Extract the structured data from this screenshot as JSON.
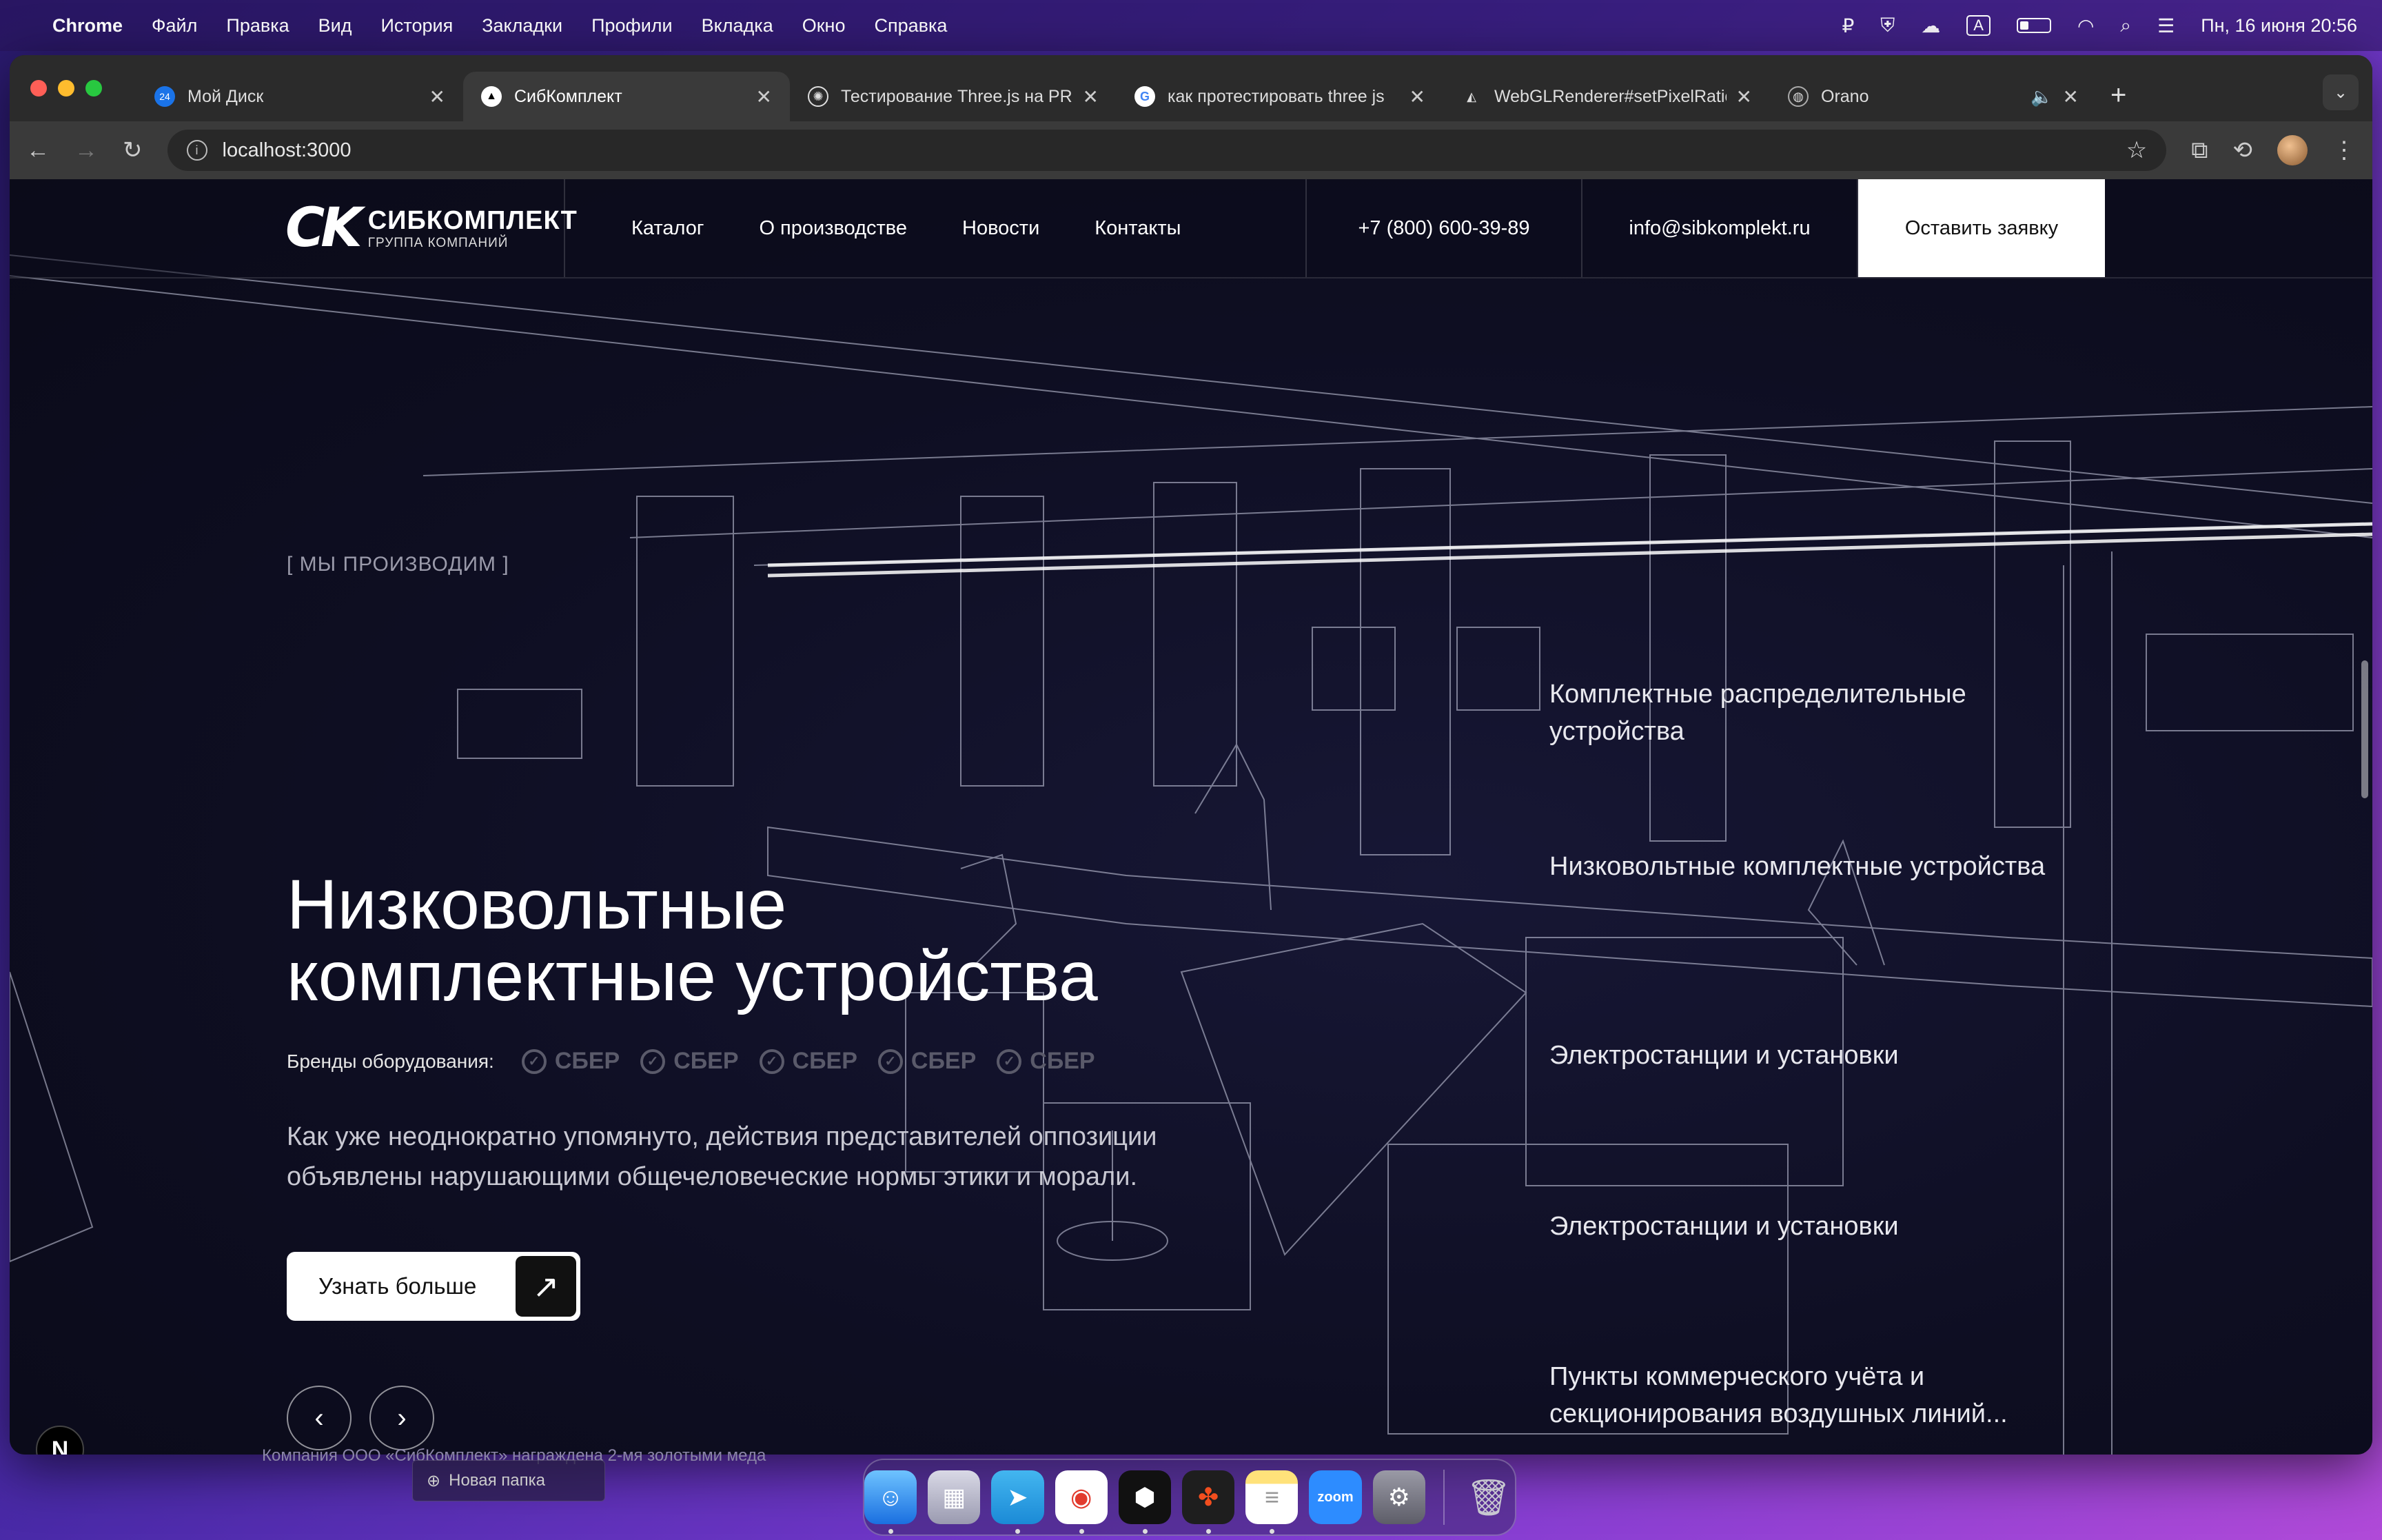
{
  "menubar": {
    "app": "Chrome",
    "items": [
      "Файл",
      "Правка",
      "Вид",
      "История",
      "Закладки",
      "Профили",
      "Вкладка",
      "Окно",
      "Справка"
    ],
    "input_indicator": "A",
    "datetime": "Пн, 16 июня  20:56"
  },
  "browser": {
    "tabs": [
      {
        "title": "Мой Диск",
        "favicon": "drive-icon",
        "favicon_badge": "24"
      },
      {
        "title": "СибКомплект",
        "favicon": "triangle-icon",
        "active": true
      },
      {
        "title": "Тестирование Three.js на PR",
        "favicon": "openai-icon"
      },
      {
        "title": "как протестировать three js",
        "favicon": "google-icon"
      },
      {
        "title": "WebGLRenderer#setPixelRatio",
        "favicon": "threejs-icon"
      },
      {
        "title": "Orano",
        "favicon": "globe-icon"
      }
    ],
    "url": "localhost:3000"
  },
  "site": {
    "logo": {
      "mark": "CK",
      "title": "СИБКОМПЛЕКТ",
      "subtitle": "ГРУППА КОМПАНИЙ"
    },
    "nav": [
      "Каталог",
      "О производстве",
      "Новости",
      "Контакты"
    ],
    "phone": "+7 (800) 600-39-89",
    "email": "info@sibkomplekt.ru",
    "cta": "Оставить заявку",
    "eyebrow": "[ МЫ ПРОИЗВОДИМ ]",
    "hero_title_line1": "Низковольтные",
    "hero_title_line2": "комплектные устройства",
    "brands_label": "Бренды оборудования:",
    "brands": [
      "СБЕР",
      "СБЕР",
      "СБЕР",
      "СБЕР",
      "СБЕР"
    ],
    "description": "Как уже неоднократно упомянуто, действия представителей оппозиции объявлены нарушающими общечеловеческие нормы этики и морали.",
    "more_button": "Узнать больше",
    "categories": [
      "Комплектные распределительные устройства",
      "Низковольтные комплектные устройства",
      "Электростанции и установки",
      "Электростанции и установки",
      "Пункты коммерческого учёта и секционирования воздушных линий..."
    ],
    "next_badge": "N"
  },
  "desktop": {
    "behind_window_text": "Компания ООО «СибКомплект» награждена 2-мя золотыми меда",
    "folder": "Новая папка"
  },
  "dock": [
    "finder-icon",
    "launchpad-icon",
    "telegram-icon",
    "chrome-icon",
    "cube-app-icon",
    "figma-icon",
    "notes-icon",
    "zoom-icon",
    "settings-icon",
    "trash-icon"
  ],
  "colors": {
    "page_bg": "#0e0e22",
    "accent_white": "#ffffff",
    "brand_muted": "#5a5a6a"
  }
}
